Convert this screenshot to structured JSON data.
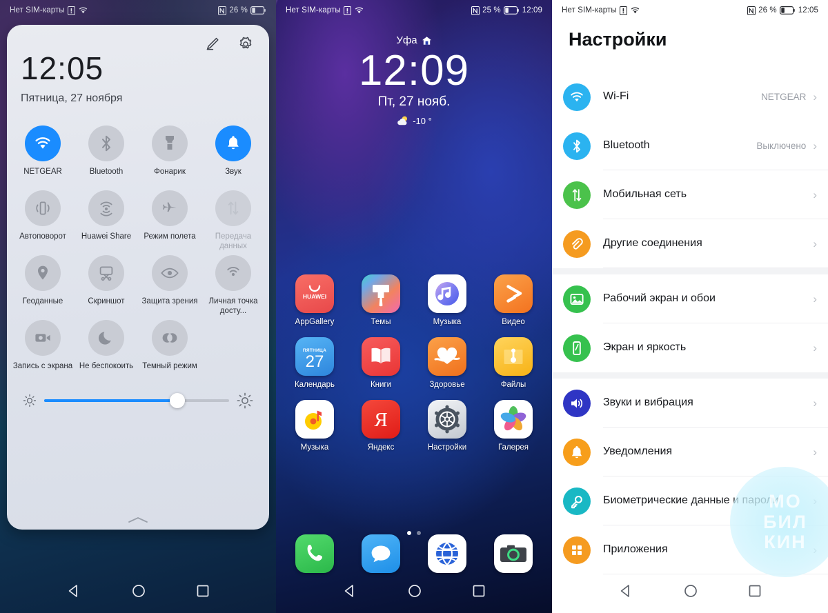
{
  "shade": {
    "statusbar": {
      "carrier": "Нет SIM-карты",
      "nfc": "N",
      "battery_pct": "26 %"
    },
    "clock": "12:05",
    "date": "Пятница, 27 ноября",
    "edit_label": "edit-icon",
    "settings_label": "gear-icon",
    "tiles": [
      {
        "label": "NETGEAR",
        "icon": "wifi-icon",
        "state": "on"
      },
      {
        "label": "Bluetooth",
        "icon": "bluetooth-icon",
        "state": "off"
      },
      {
        "label": "Фонарик",
        "icon": "flashlight-icon",
        "state": "off"
      },
      {
        "label": "Звук",
        "icon": "bell-icon",
        "state": "on"
      },
      {
        "label": "Автоповорот",
        "icon": "rotate-icon",
        "state": "off"
      },
      {
        "label": "Huawei Share",
        "icon": "share-icon",
        "state": "off"
      },
      {
        "label": "Режим полета",
        "icon": "airplane-icon",
        "state": "off"
      },
      {
        "label": "Передача данных",
        "icon": "data-transfer-icon",
        "state": "disabled"
      },
      {
        "label": "Геоданные",
        "icon": "location-pin-icon",
        "state": "off"
      },
      {
        "label": "Скриншот",
        "icon": "screenshot-icon",
        "state": "off"
      },
      {
        "label": "Защита зрения",
        "icon": "eye-icon",
        "state": "off"
      },
      {
        "label": "Личная точка досту...",
        "icon": "hotspot-icon",
        "state": "off"
      },
      {
        "label": "Запись с экрана",
        "icon": "screen-record-icon",
        "state": "off"
      },
      {
        "label": "Не беспокоить",
        "icon": "moon-icon",
        "state": "off"
      },
      {
        "label": "Темный режим",
        "icon": "dark-mode-icon",
        "state": "off"
      }
    ],
    "brightness": {
      "value": 72,
      "low_icon": "brightness-low-icon",
      "high_icon": "brightness-high-icon"
    },
    "accent_color": "#1a8cff"
  },
  "home": {
    "statusbar": {
      "carrier": "Нет SIM-карты",
      "nfc": "N",
      "battery_pct": "25 %",
      "time": "12:09"
    },
    "city": "Уфа",
    "time": "12:09",
    "date": "Пт, 27 нояб.",
    "weather": "-10 °",
    "apps": [
      [
        {
          "name": "AppGallery",
          "icon": "appgallery-icon",
          "color": "#f4605d"
        },
        {
          "name": "Темы",
          "icon": "themes-icon",
          "color": "#f08a6b"
        },
        {
          "name": "Музыка",
          "icon": "music-huawei-icon",
          "color": "#ffffff"
        },
        {
          "name": "Видео",
          "icon": "video-icon",
          "color": "#f58a3a"
        }
      ],
      [
        {
          "name": "Календарь",
          "icon": "calendar-icon",
          "color": "#3aa0ef",
          "top": "ПЯТНИЦА",
          "day": "27"
        },
        {
          "name": "Книги",
          "icon": "books-icon",
          "color": "#ef4b4b"
        },
        {
          "name": "Здоровье",
          "icon": "health-icon",
          "color": "#f2842b"
        },
        {
          "name": "Файлы",
          "icon": "files-icon",
          "color": "#ffc33d"
        }
      ],
      [
        {
          "name": "Музыка",
          "icon": "yandex-music-icon",
          "color": "#ffffff"
        },
        {
          "name": "Яндекс",
          "icon": "yandex-icon",
          "color": "#ef3124"
        },
        {
          "name": "Настройки",
          "icon": "settings-gear-icon",
          "color": "#d8dade"
        },
        {
          "name": "Галерея",
          "icon": "gallery-icon",
          "color": "#ffffff"
        }
      ]
    ],
    "dock": [
      {
        "name": "phone-icon",
        "color": "#3ec75a"
      },
      {
        "name": "messages-icon",
        "color": "#2196f3"
      },
      {
        "name": "browser-icon",
        "color": "#ffffff"
      },
      {
        "name": "camera-icon",
        "color": "#ffffff"
      }
    ],
    "pages": {
      "count": 2,
      "active": 0
    }
  },
  "settings": {
    "statusbar": {
      "carrier": "Нет SIM-карты",
      "nfc": "N",
      "battery_pct": "26 %",
      "time": "12:05"
    },
    "title": "Настройки",
    "groups": [
      [
        {
          "label": "Wi-Fi",
          "value": "NETGEAR",
          "icon": "wifi-icon",
          "color": "#2bb3f0"
        },
        {
          "label": "Bluetooth",
          "value": "Выключено",
          "icon": "bluetooth-icon",
          "color": "#2bb3f0"
        },
        {
          "label": "Мобильная сеть",
          "value": "",
          "icon": "mobile-network-icon",
          "color": "#4bc24b"
        },
        {
          "label": "Другие соединения",
          "value": "",
          "icon": "other-connections-icon",
          "color": "#f59b20"
        }
      ],
      [
        {
          "label": "Рабочий экран и обои",
          "value": "",
          "icon": "wallpaper-icon",
          "color": "#36c14e"
        },
        {
          "label": "Экран и яркость",
          "value": "",
          "icon": "display-icon",
          "color": "#36c14e"
        }
      ],
      [
        {
          "label": "Звуки и вибрация",
          "value": "",
          "icon": "sound-icon",
          "color": "#2f35c4"
        },
        {
          "label": "Уведомления",
          "value": "",
          "icon": "notifications-bell-icon",
          "color": "#f79e1b"
        },
        {
          "label": "Биометрические данные и пароли",
          "value": "",
          "icon": "biometrics-key-icon",
          "color": "#19b8c4"
        },
        {
          "label": "Приложения",
          "value": "",
          "icon": "apps-grid-icon",
          "color": "#f59b20"
        }
      ]
    ],
    "chevron": "›",
    "watermark": [
      "МО",
      "БИЛ",
      "КИН"
    ]
  },
  "navbar": {
    "back": "back-triangle-icon",
    "home": "home-circle-icon",
    "recents": "recents-square-icon"
  }
}
